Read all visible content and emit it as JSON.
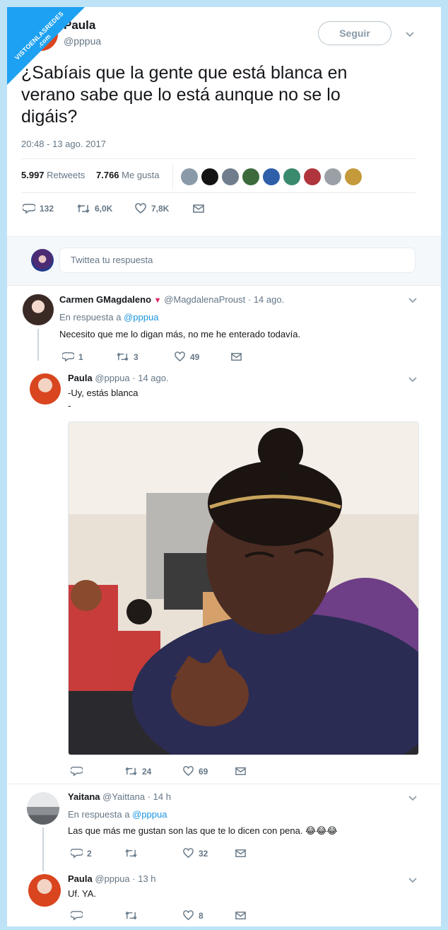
{
  "watermark": "VISTOENLASREDES .com",
  "tweet": {
    "author_name": "Paula",
    "author_handle": "@pppua",
    "follow_label": "Seguir",
    "text_line1": "¿Sabíais que la gente que está blanca en",
    "text_line2": "verano sabe que lo está aunque no se lo",
    "text_line3": "digáis?",
    "timestamp": "20:48 - 13 ago. 2017",
    "retweets_count": "5.997",
    "retweets_label": "Retweets",
    "likes_count": "7.766",
    "likes_label": "Me gusta",
    "replies": "132",
    "retweets_short": "6,0K",
    "likes_short": "7,8K"
  },
  "reply_box": {
    "placeholder": "Twittea tu respuesta"
  },
  "replies": [
    {
      "name": "Carmen GMagdaleno",
      "handle_time": "@MagdalenaProust · 14 ago.",
      "in_reply_prefix": "En respuesta a",
      "in_reply_handle": "@pppua",
      "text": "Necesito que me lo digan más, no me he enterado todavía.",
      "replies": "1",
      "retweets": "3",
      "likes": "49"
    },
    {
      "name": "Paula",
      "handle_time": "@pppua · 14 ago.",
      "text_line1": "-Uy, estás blanca",
      "text_line2": "-",
      "replies": "",
      "retweets": "24",
      "likes": "69"
    },
    {
      "name": "Yaitana",
      "handle_time": "@Yaittana · 14 h",
      "in_reply_prefix": "En respuesta a",
      "in_reply_handle": "@pppua",
      "text": "Las que más me gustan son las que te lo dicen con pena. 😂😂😂",
      "replies": "2",
      "retweets": "",
      "likes": "32"
    },
    {
      "name": "Paula",
      "handle_time": "@pppua · 13 h",
      "text": "Uf. YA.",
      "replies": "",
      "retweets": "",
      "likes": "8"
    }
  ],
  "colors": {
    "accent": "#1da1f2",
    "muted": "#657786",
    "text": "#14171a"
  }
}
